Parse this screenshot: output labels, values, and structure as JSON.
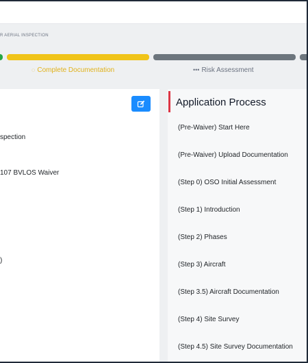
{
  "header": {
    "breadcrumb": "R AERIAL INSPECTION"
  },
  "progress": {
    "steps": [
      {
        "state": "done",
        "color": "#28a745"
      },
      {
        "state": "current",
        "label": "Complete Documentation",
        "icon": "spinner-icon",
        "icon_glyph": "◌",
        "color": "#f0c419"
      },
      {
        "state": "pending",
        "label": "Risk Assessment",
        "icon": "ellipsis-icon",
        "icon_glyph": "•••",
        "color": "#6c757d"
      },
      {
        "state": "pending",
        "color": "#6c757d"
      }
    ]
  },
  "left_panel": {
    "edit_icon": "edit-icon",
    "line1": "spection",
    "line2": "107 BVLOS Waiver",
    "line3": ")"
  },
  "application_process": {
    "title": "Application Process",
    "accent_color": "#dc3545",
    "items": [
      "(Pre-Waiver) Start Here",
      "(Pre-Waiver) Upload Documentation",
      "(Step 0) OSO Initial Assessment",
      "(Step 1) Introduction",
      "(Step 2) Phases",
      "(Step 3) Aircraft",
      "(Step 3.5) Aircraft Documentation",
      "(Step 4) Site Survey",
      "(Step 4.5) Site Survey Documentation"
    ]
  }
}
